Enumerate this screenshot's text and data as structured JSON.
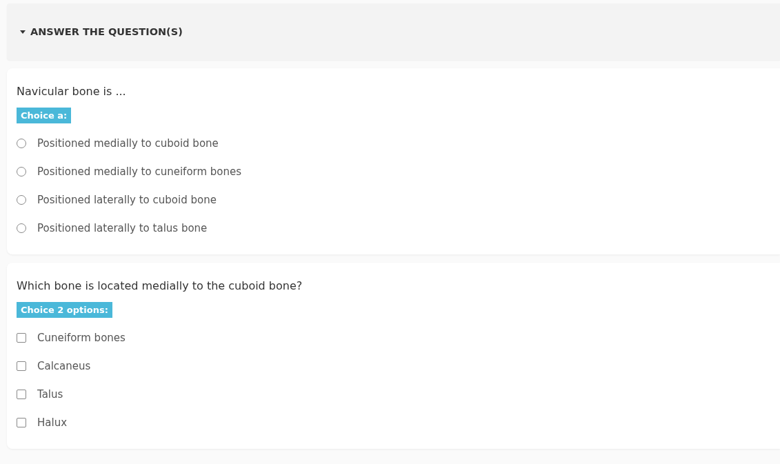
{
  "section": {
    "title": "ANSWER THE QUESTION(S)",
    "expanded": true
  },
  "questions": [
    {
      "kind": "single",
      "text": "Navicular bone is ...",
      "badge": "Choice a:",
      "options": [
        {
          "label": "Positioned medially to cuboid bone",
          "checked": false
        },
        {
          "label": "Positioned medially to cuneiform bones",
          "checked": false
        },
        {
          "label": "Positioned laterally to cuboid bone",
          "checked": false
        },
        {
          "label": "Positioned laterally to talus bone",
          "checked": false
        }
      ]
    },
    {
      "kind": "multiple",
      "text": "Which bone is located medially to the cuboid bone?",
      "badge": "Choice 2 options:",
      "options": [
        {
          "label": "Cuneiform bones",
          "checked": false
        },
        {
          "label": "Calcaneus",
          "checked": false
        },
        {
          "label": "Talus",
          "checked": false
        },
        {
          "label": "Halux",
          "checked": false
        }
      ]
    }
  ]
}
